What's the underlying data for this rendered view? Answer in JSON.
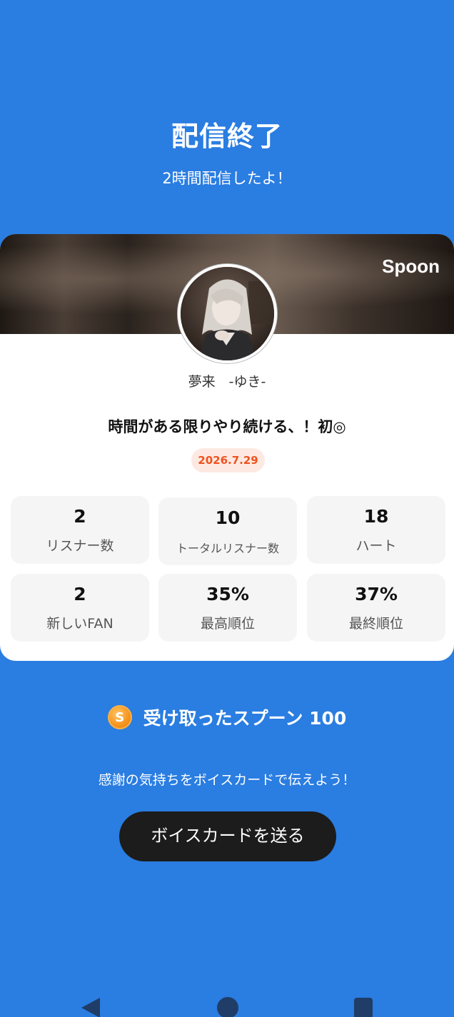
{
  "header": {
    "title": "配信終了",
    "subtitle": "2時間配信したよ！"
  },
  "card": {
    "banner_logo": "Spoon",
    "nickname": "夢来　-ゆき-",
    "live_title": "時間がある限りやり続ける、！初◎",
    "date": "2026.7.29",
    "stats": [
      {
        "value": "2",
        "label": "リスナー数"
      },
      {
        "value": "10",
        "label": "トータルリスナー数"
      },
      {
        "value": "18",
        "label": "ハート"
      },
      {
        "value": "2",
        "label": "新しいFAN"
      },
      {
        "value": "35%",
        "label": "最高順位"
      },
      {
        "value": "37%",
        "label": "最終順位"
      }
    ]
  },
  "spoons": {
    "coin_letter": "S",
    "text": "受け取ったスプーン  100"
  },
  "thanks_text": "感謝の気持ちをボイスカードで伝えよう！",
  "voice_card_button": "ボイスカードを送る",
  "colors": {
    "background": "#2a7de1",
    "date_accent": "#f0521e",
    "button_bg": "#1c1c1c"
  }
}
